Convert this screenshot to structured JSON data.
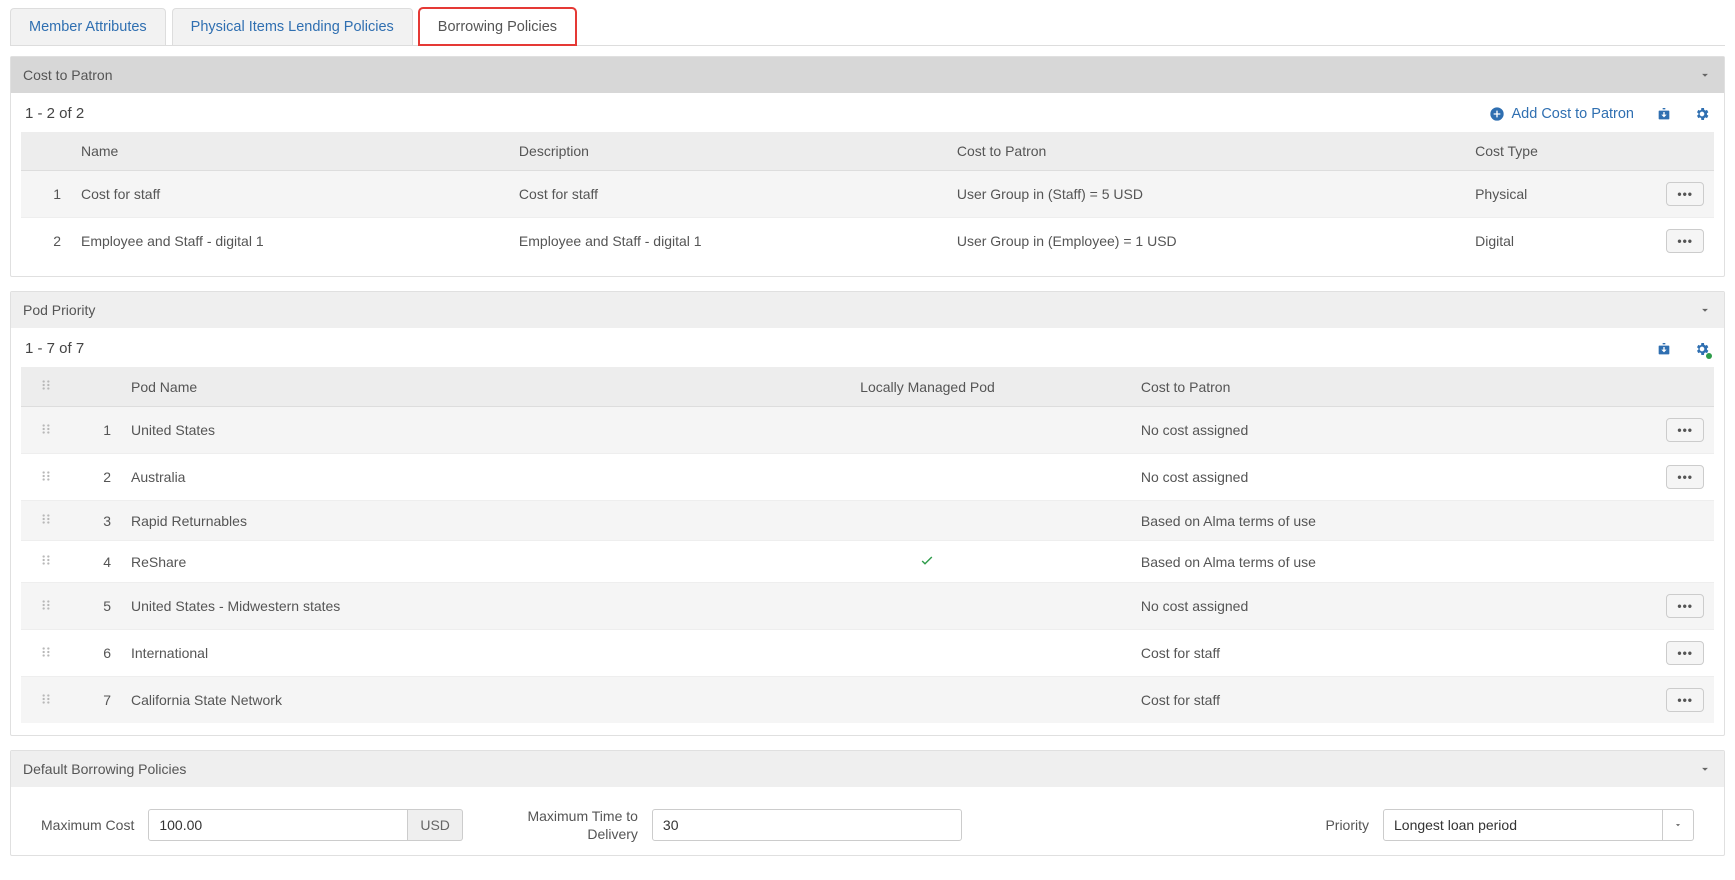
{
  "tabs": {
    "member_attributes": "Member Attributes",
    "lending_policies": "Physical Items Lending Policies",
    "borrowing_policies": "Borrowing Policies"
  },
  "cost_to_patron": {
    "title": "Cost to Patron",
    "count": "1 - 2 of 2",
    "add_label": "Add Cost to Patron",
    "columns": {
      "name": "Name",
      "description": "Description",
      "cost": "Cost to Patron",
      "cost_type": "Cost Type"
    },
    "rows": [
      {
        "idx": "1",
        "name": "Cost for staff",
        "description": "Cost for staff",
        "cost": "User Group in (Staff) = 5 USD",
        "cost_type": "Physical"
      },
      {
        "idx": "2",
        "name": "Employee and Staff - digital 1",
        "description": "Employee and Staff - digital 1",
        "cost": "User Group in (Employee) = 1 USD",
        "cost_type": "Digital"
      }
    ]
  },
  "pod_priority": {
    "title": "Pod Priority",
    "count": "1 - 7 of 7",
    "columns": {
      "pod_name": "Pod Name",
      "locally_managed": "Locally Managed Pod",
      "cost": "Cost to Patron"
    },
    "rows": [
      {
        "idx": "1",
        "pod_name": "United States",
        "locally_managed": false,
        "cost": "No cost assigned",
        "has_actions": true
      },
      {
        "idx": "2",
        "pod_name": "Australia",
        "locally_managed": false,
        "cost": "No cost assigned",
        "has_actions": true
      },
      {
        "idx": "3",
        "pod_name": "Rapid Returnables",
        "locally_managed": false,
        "cost": "Based on Alma terms of use",
        "has_actions": false
      },
      {
        "idx": "4",
        "pod_name": "ReShare",
        "locally_managed": true,
        "cost": "Based on Alma terms of use",
        "has_actions": false
      },
      {
        "idx": "5",
        "pod_name": "United States - Midwestern states",
        "locally_managed": false,
        "cost": "No cost assigned",
        "has_actions": true
      },
      {
        "idx": "6",
        "pod_name": "International",
        "locally_managed": false,
        "cost": "Cost for staff",
        "has_actions": true
      },
      {
        "idx": "7",
        "pod_name": "California State Network",
        "locally_managed": false,
        "cost": "Cost for staff",
        "has_actions": true
      }
    ]
  },
  "default_policies": {
    "title": "Default Borrowing Policies",
    "max_cost_label": "Maximum Cost",
    "max_cost_value": "100.00",
    "max_cost_currency": "USD",
    "max_time_label": "Maximum Time to Delivery",
    "max_time_value": "30",
    "priority_label": "Priority",
    "priority_value": "Longest loan period"
  },
  "icons": {
    "more": "•••"
  }
}
